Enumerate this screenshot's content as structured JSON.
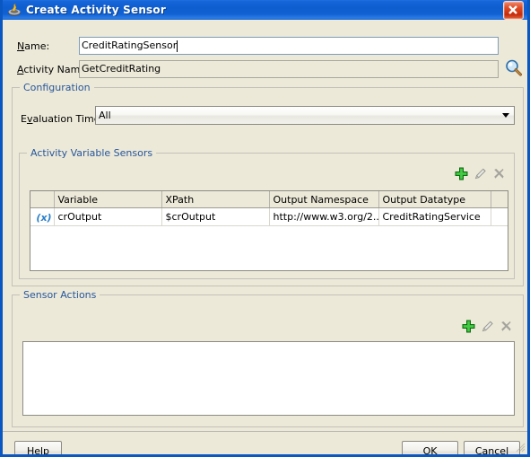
{
  "window": {
    "title": "Create Activity Sensor",
    "icon": "java-bean-icon",
    "close_label": "X",
    "border_color": "#0a57c2",
    "titlebar_color": "#1160d2",
    "background_color": "#ece9d8"
  },
  "form": {
    "name_label": "Name:",
    "name_mnemonic": "N",
    "name_value": "CreditRatingSensor",
    "activity_name_label": "Activity Name:",
    "activity_mnemonic": "A",
    "activity_name_value": "GetCreditRating",
    "browse_icon": "magnifier-icon"
  },
  "configuration": {
    "group_title": "Configuration",
    "evaluation_time_label": "Evaluation Time:",
    "evaluation_time_mnemonic": "v",
    "evaluation_time_value": "All",
    "evaluation_time_options": [
      "All"
    ]
  },
  "activity_variable_sensors": {
    "group_title": "Activity Variable Sensors",
    "toolbar": [
      {
        "name": "add-variable-sensor-button",
        "icon": "plus-icon",
        "enabled": true
      },
      {
        "name": "edit-variable-sensor-button",
        "icon": "pencil-icon",
        "enabled": false
      },
      {
        "name": "delete-variable-sensor-button",
        "icon": "delete-x-icon",
        "enabled": false
      }
    ],
    "columns": [
      "",
      "Variable",
      "XPath",
      "Output Namespace",
      "Output Datatype",
      ""
    ],
    "rows": [
      {
        "icon": "variable-x-icon",
        "variable": "crOutput",
        "xpath": "$crOutput",
        "output_namespace": "http://www.w3.org/2...",
        "output_datatype": "CreditRatingService"
      }
    ]
  },
  "sensor_actions": {
    "group_title": "Sensor Actions",
    "toolbar": [
      {
        "name": "add-sensor-action-button",
        "icon": "plus-icon",
        "enabled": true
      },
      {
        "name": "edit-sensor-action-button",
        "icon": "pencil-icon",
        "enabled": false
      },
      {
        "name": "delete-sensor-action-button",
        "icon": "delete-x-icon",
        "enabled": false
      }
    ],
    "items": []
  },
  "footer": {
    "help_label": "Help",
    "help_mnemonic": "H",
    "ok_label": "OK",
    "cancel_label": "Cancel"
  },
  "colors": {
    "group_title_text": "#27569c",
    "accent_green": "#22a522",
    "disabled_gray": "#8e8e88",
    "variable_icon_blue": "#2a7fc9"
  }
}
